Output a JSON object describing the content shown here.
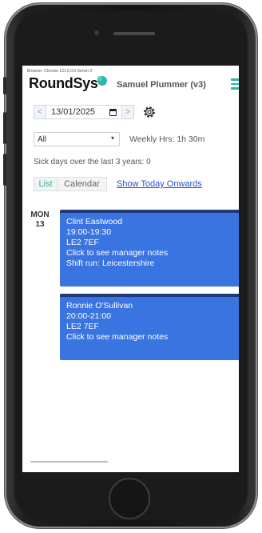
{
  "browser": {
    "info": "Browser: Chrome 131.0.0.0 Server 2"
  },
  "header": {
    "logo": "RoundSys",
    "user": "Samuel Plummer (v3)"
  },
  "date_nav": {
    "prev": "<",
    "date": "13/01/2025",
    "next": ">"
  },
  "filter": {
    "selected": "All",
    "weekly_hours": "Weekly Hrs: 1h 30m"
  },
  "sick_days": "Sick days over the last 3 years: 0",
  "view_tabs": {
    "list": "List",
    "calendar": "Calendar",
    "show_today": "Show Today Onwards"
  },
  "day": {
    "weekday": "MON",
    "date": "13"
  },
  "shifts": [
    {
      "name": "Clint Eastwood",
      "time": "19:00-19:30",
      "postcode": "LE2 7EF",
      "notes": "Click to see manager notes",
      "run": "Shift run: Leicestershire"
    },
    {
      "name": "Ronnie O'Sullivan",
      "time": "20:00-21:00",
      "postcode": "LE2 7EF",
      "notes": "Click to see manager notes"
    }
  ],
  "colors": {
    "accent": "#33b5a5",
    "shift_bg": "#3a74e0",
    "shift_border": "#1d3a7a",
    "link": "#2b52c9"
  }
}
